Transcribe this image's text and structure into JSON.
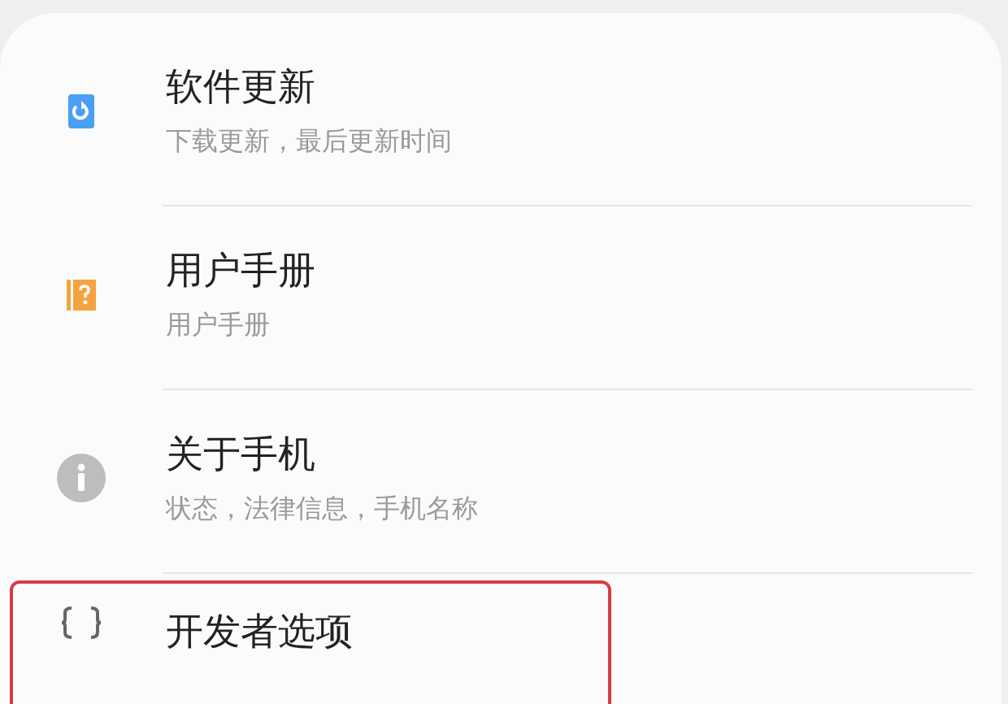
{
  "items": [
    {
      "kind": "update",
      "title": "软件更新",
      "subtitle": "下载更新，最后更新时间",
      "highlighted": false
    },
    {
      "kind": "manual",
      "title": "用户手册",
      "subtitle": "用户手册",
      "highlighted": false
    },
    {
      "kind": "info",
      "title": "关于手机",
      "subtitle": "状态，法律信息，手机名称",
      "highlighted": false
    },
    {
      "kind": "braces",
      "title": "开发者选项",
      "highlighted": true
    }
  ]
}
